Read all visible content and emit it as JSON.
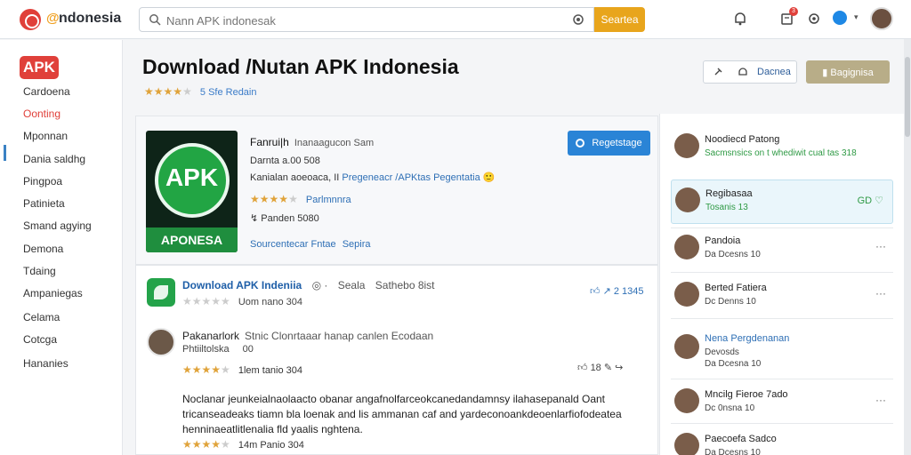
{
  "header": {
    "logo_mark": "@",
    "logo_text": "ndonesia",
    "search_placeholder": "Nann APK indonesak",
    "search_button": "Seartea"
  },
  "notifications_count": "3",
  "sidebar": {
    "badge": "APK",
    "items": [
      {
        "label": "Cardoena"
      },
      {
        "label": "Oonting"
      },
      {
        "label": "Mponnan"
      },
      {
        "label": "Dania  saldhg"
      },
      {
        "label": "Pingpoa"
      },
      {
        "label": "Patinieta"
      },
      {
        "label": "Smand agying"
      },
      {
        "label": "Demona"
      },
      {
        "label": "Tdaing"
      },
      {
        "label": "Ampaniegas"
      },
      {
        "label": "Celama"
      },
      {
        "label": "Cotcga"
      },
      {
        "label": "Hananies"
      }
    ]
  },
  "page": {
    "title": "Download /Nutan APK Indonesia",
    "rating_link": "5 Sfe Redain",
    "share_label": "Dacnea",
    "download_label": "Bagignisa"
  },
  "app": {
    "icon_text": "APK",
    "icon_band": "APONESA",
    "name": "Fanrui|h",
    "name_sub": "Inanaagucon Sam",
    "version": "Darnta  a.00 508",
    "desc_prefix": "Kanialan aoeoaca, II",
    "desc_link": "Pregeneacr /APKtas Pegentatia",
    "rating_link": "Parlmnnra",
    "downloads": "Panden 5080",
    "tags_link": "Sourcentecar Fntae",
    "tags_link2": "Sepira",
    "download_button": "Regetstage"
  },
  "post": {
    "title": "Download APK Indeniia",
    "meta_1": "Seala",
    "meta_2": "Sathebo  8ist",
    "date": "Uom nano 304",
    "likes": "2",
    "count": "1345"
  },
  "review": {
    "name": "Pakanarlork",
    "name_meta": "Stnic Clonrtaaar  hanap canlen  Ecodaan",
    "sub": "Phtiiltolska",
    "sub_count": "00",
    "date": "1lem tanio 304",
    "likes": "18",
    "body": "Noclanar jeunkeialnaolaacto obanar angafnolfarceokcanedandamnsy ilahasepanald Oant tricanseadeaks tiamn  bla loenak and lis ammanan  caf and yardeconoankdeoenlarfiofodeatea henninaeatlitlenalia  fld yaalis nghtena.",
    "date2": "14m Panio 304"
  },
  "right_panel": {
    "users": [
      {
        "name": "Noodiecd Patong",
        "status": "Sacmsnsics on t  whediwit  cual tas 318",
        "style": "green"
      },
      {
        "name": "Regibasaa",
        "status": "Tosanis 13",
        "style": "highlight",
        "icons": "GD ♡"
      },
      {
        "name": "Pandoia",
        "status": "Da Dcesns 10"
      },
      {
        "name": "Berted Fatiera",
        "status": "Dc Denns 10"
      },
      {
        "name": "Nena Pergdenanan",
        "status": "Devosds",
        "status2": "Da Dcesna 10",
        "style": "blue"
      },
      {
        "name": "Mncilg Fieroe 7ado",
        "status": "Dc 0nsna 10"
      },
      {
        "name": "Paecoefa Sadco",
        "status": "Da Dcesns 10"
      }
    ]
  },
  "colors": {
    "accent_orange": "#e8a51c",
    "brand_red": "#e0403a",
    "link_blue": "#2e6fb5",
    "primary_blue": "#2a84d6",
    "apk_green": "#22a544"
  }
}
